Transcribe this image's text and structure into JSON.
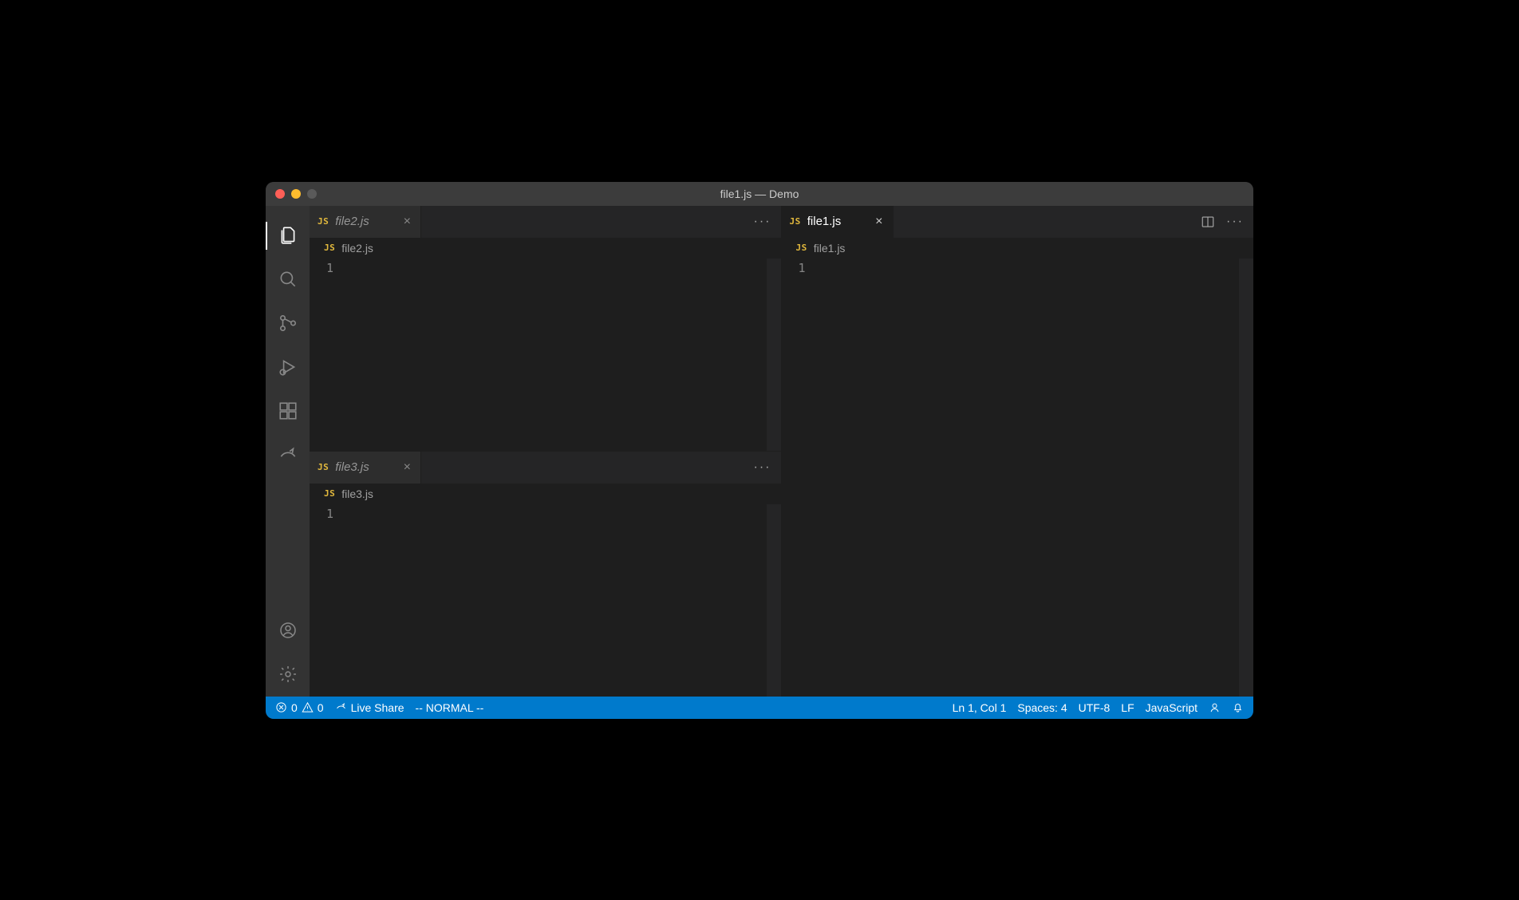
{
  "window": {
    "title": "file1.js — Demo"
  },
  "activitybar": {
    "top": [
      "files-icon",
      "search-icon",
      "source-control-icon",
      "debug-icon",
      "extensions-icon",
      "live-share-icon"
    ],
    "bottom": [
      "account-icon",
      "settings-gear-icon"
    ]
  },
  "panes": {
    "topLeft": {
      "tab": {
        "filename": "file2.js",
        "italic": true,
        "active": false
      },
      "breadcrumb": "file2.js",
      "line": "1"
    },
    "bottomLeft": {
      "tab": {
        "filename": "file3.js",
        "italic": true,
        "active": false
      },
      "breadcrumb": "file3.js",
      "line": "1"
    },
    "right": {
      "tab": {
        "filename": "file1.js",
        "italic": false,
        "active": true
      },
      "breadcrumb": "file1.js",
      "line": "1"
    }
  },
  "status": {
    "errors": "0",
    "warnings": "0",
    "liveShare": "Live Share",
    "vimMode": "-- NORMAL --",
    "position": "Ln 1, Col 1",
    "spaces": "Spaces: 4",
    "encoding": "UTF-8",
    "eol": "LF",
    "language": "JavaScript"
  }
}
